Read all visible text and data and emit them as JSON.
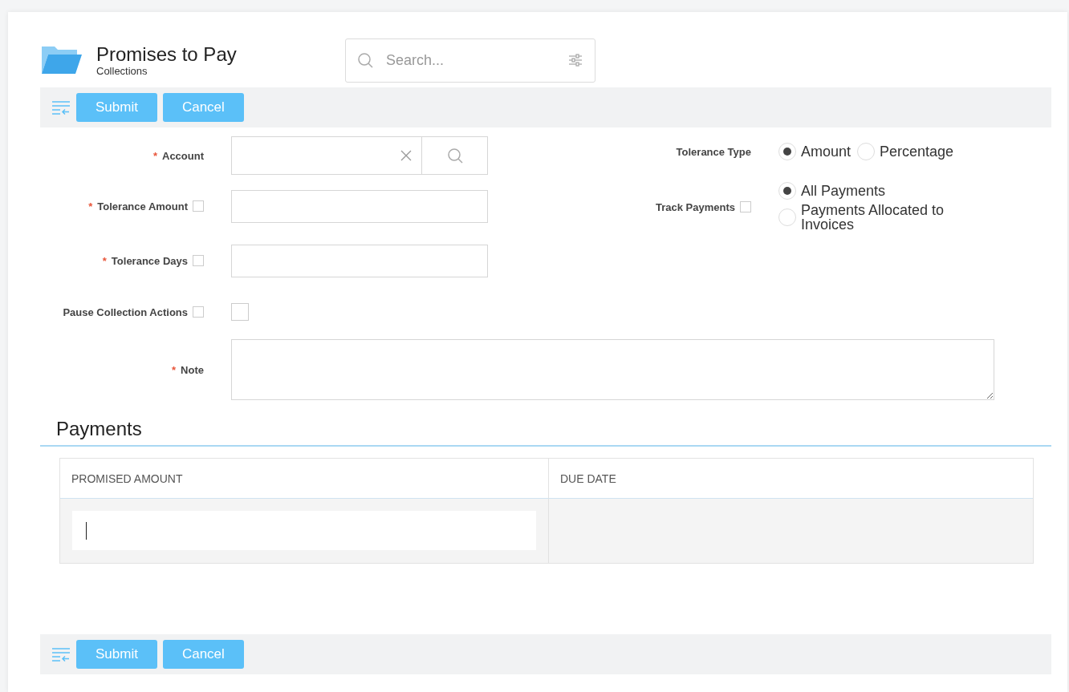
{
  "header": {
    "title": "Promises to Pay",
    "subtitle": "Collections"
  },
  "search": {
    "placeholder": "Search..."
  },
  "top_toolbar": {
    "buttons": [
      "Submit",
      "Cancel"
    ]
  },
  "left_fields": [
    {
      "kind": "lookup",
      "required_mark": "*",
      "label": "Account",
      "help": false
    },
    {
      "kind": "text",
      "required_mark": "*",
      "label": "Tolerance Amount",
      "help": true
    },
    {
      "kind": "text",
      "required_mark": "*",
      "label": "Tolerance Days",
      "help": true
    },
    {
      "kind": "checkbox",
      "label": "Pause Collection Actions",
      "help": true,
      "checked": false
    }
  ],
  "right_fields": [
    {
      "kind": "inline",
      "label": "Tolerance Type",
      "help": false,
      "options": [
        {
          "label": "Amount",
          "selected": true
        },
        {
          "label": "Percentage",
          "selected": false
        }
      ]
    },
    {
      "kind": "stacked",
      "label": "Track Payments",
      "help": true,
      "options": [
        {
          "label": "All Payments",
          "selected": true
        },
        {
          "label": "Payments Allocated to Invoices",
          "selected": false
        }
      ]
    }
  ],
  "note": {
    "required_mark": "*",
    "label": "Note"
  },
  "payments": {
    "title": "Payments",
    "columns": [
      "PROMISED AMOUNT",
      "DUE DATE"
    ],
    "rows": [
      {
        "cells": [
          {
            "kind": "input",
            "focused": true
          },
          {
            "kind": "empty"
          }
        ]
      }
    ]
  },
  "bottom_toolbar": {
    "buttons": [
      "Submit",
      "Cancel"
    ]
  }
}
